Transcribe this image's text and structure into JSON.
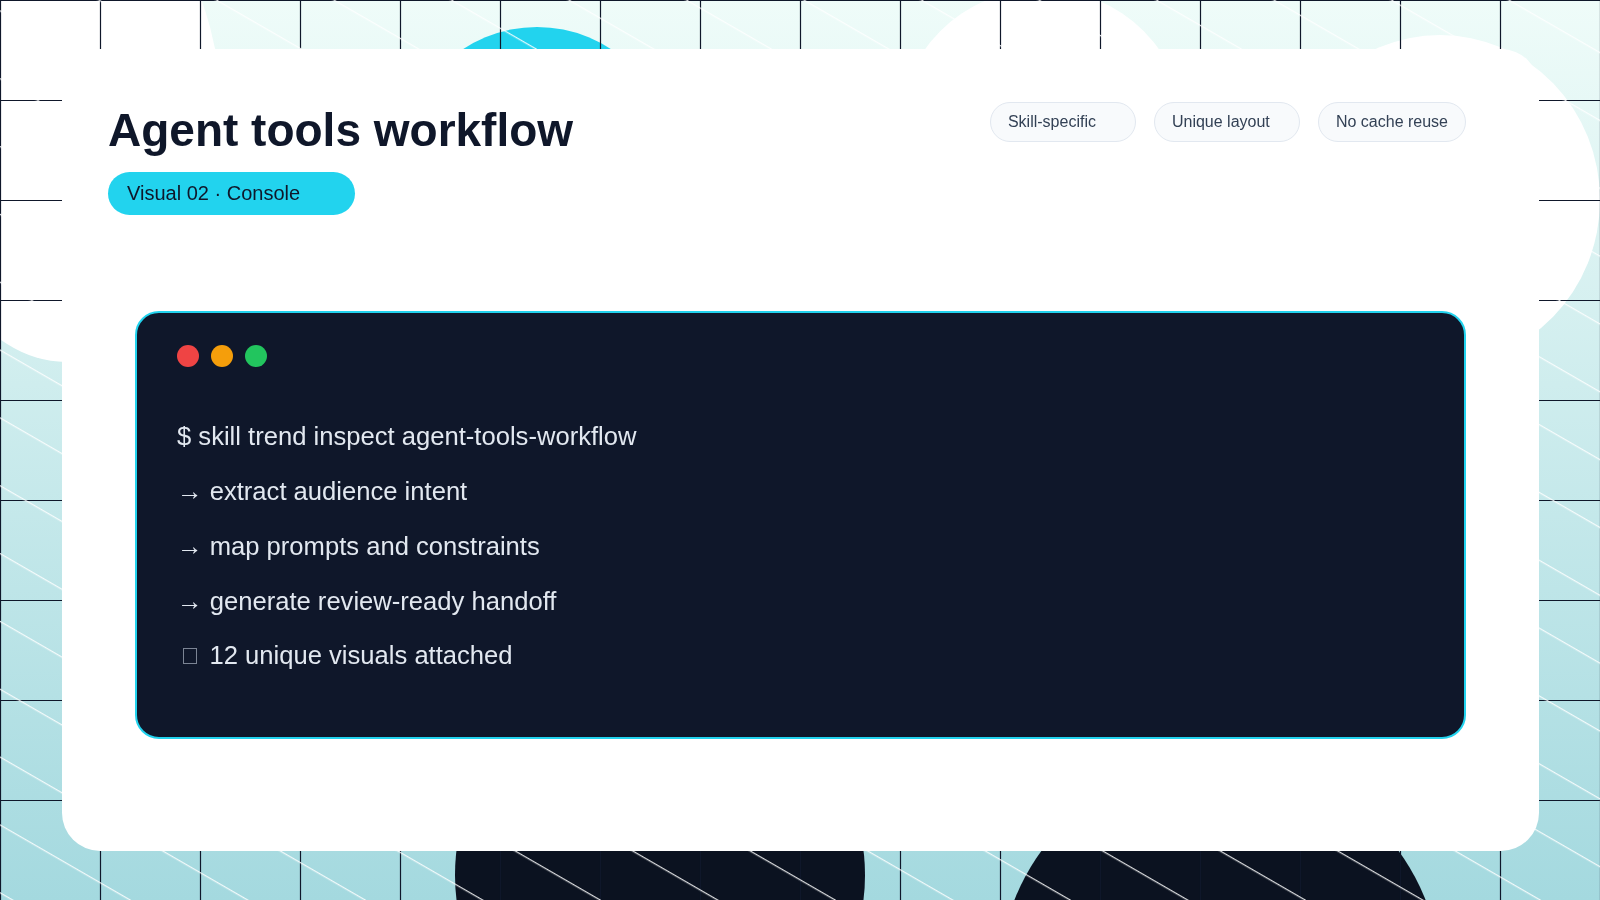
{
  "header": {
    "title": "Agent tools workflow",
    "tag": "Visual 02 · Console",
    "chips": [
      "Skill-specific",
      "Unique layout",
      "No cache reuse"
    ]
  },
  "console": {
    "dots": [
      {
        "color": "#ef4444"
      },
      {
        "color": "#f59e0b"
      },
      {
        "color": "#22c55e"
      }
    ],
    "lines": [
      {
        "kind": "text",
        "text": "$ skill trend inspect agent-tools-workflow"
      },
      {
        "kind": "text",
        "text": "→ extract audience intent"
      },
      {
        "kind": "text",
        "text": "→ map prompts and constraints"
      },
      {
        "kind": "text",
        "text": "→ generate review-ready handoff"
      },
      {
        "kind": "icon",
        "text": "12 unique visuals attached"
      }
    ]
  }
}
